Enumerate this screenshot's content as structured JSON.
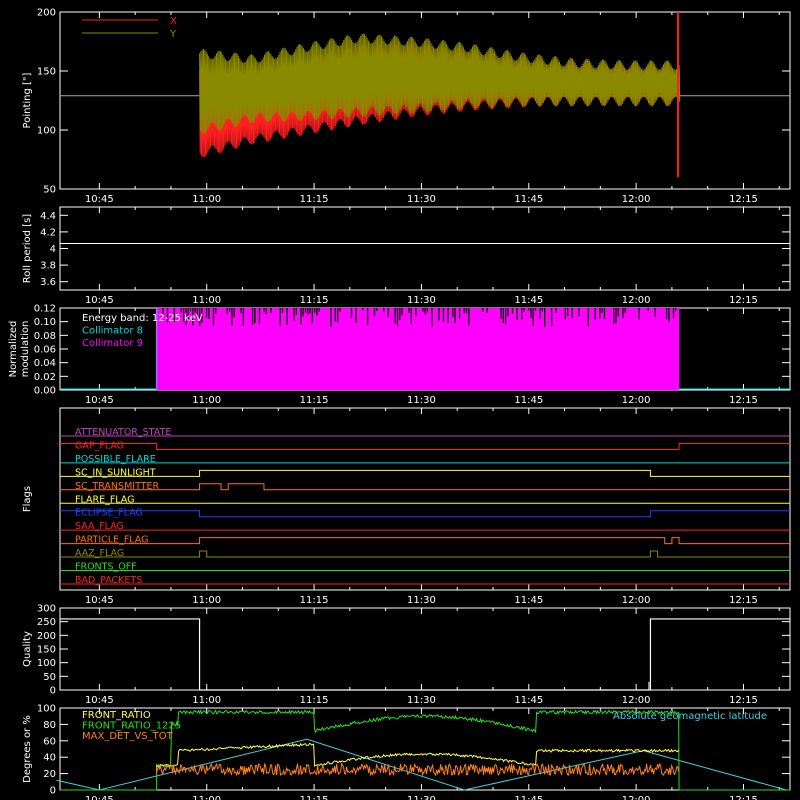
{
  "time_ticks": [
    "10:45",
    "11:00",
    "11:15",
    "11:30",
    "11:45",
    "12:00",
    "12:15"
  ],
  "chart_data": [
    {
      "type": "line",
      "ylabel": "Pointing [\"]",
      "ylim": [
        50,
        200
      ],
      "yticks": [
        50,
        100,
        150,
        200
      ],
      "legend": [
        {
          "name": "X",
          "color": "#ff2020"
        },
        {
          "name": "Y",
          "color": "#8a8a00"
        }
      ],
      "legend_position": "top-left",
      "reference_line": {
        "y": 129,
        "color": "#aaaaaa"
      },
      "series": [
        {
          "name": "X",
          "color": "#ff2020",
          "start": "10:59",
          "end": "12:06",
          "envelope_hi": [
            150,
            145,
            158,
            168,
            170,
            165,
            158,
            155,
            154,
            153
          ],
          "envelope_lo": [
            80,
            92,
            100,
            108,
            115,
            120,
            123,
            125,
            125,
            125
          ]
        },
        {
          "name": "Y",
          "color": "#8a8a00",
          "start": "10:59",
          "end": "12:06",
          "envelope_hi": [
            165,
            160,
            170,
            178,
            175,
            170,
            162,
            157,
            155,
            155
          ],
          "envelope_lo": [
            100,
            110,
            112,
            115,
            118,
            122,
            124,
            124,
            124,
            124
          ]
        }
      ]
    },
    {
      "type": "line",
      "ylabel": "Roll period [s]",
      "ylim": [
        3.5,
        4.5
      ],
      "yticks": [
        3.6,
        3.8,
        4.0,
        4.2,
        4.4
      ],
      "series": [
        {
          "name": "",
          "color": "#ffffff",
          "value": 4.06
        }
      ]
    },
    {
      "type": "bar",
      "ylabel": "Normalized modulation",
      "ylim": [
        0,
        0.12
      ],
      "yticks": [
        "0.00",
        "0.02",
        "0.04",
        "0.06",
        "0.08",
        "0.10",
        "0.12"
      ],
      "legend": [
        {
          "name": "Energy band: 12-25 keV",
          "color": "#ffffff"
        },
        {
          "name": "Collimator 8",
          "color": "#00d8d8"
        },
        {
          "name": "Collimator 9",
          "color": "#ff00ff"
        }
      ],
      "series": [
        {
          "name": "Collimator 9",
          "color": "#ff00ff",
          "start": "10:53",
          "end": "12:06"
        }
      ]
    },
    {
      "type": "table",
      "ylabel": "Flags",
      "flags": [
        {
          "name": "ATTENUATOR_STATE",
          "color": "#c040c0",
          "segments": []
        },
        {
          "name": "GAP_FLAG",
          "color": "#ff2020",
          "segments": [
            [
              "10:53",
              "12:06"
            ]
          ],
          "invert": true
        },
        {
          "name": "POSSIBLE_FLARE",
          "color": "#00d8d8",
          "segments": []
        },
        {
          "name": "SC_IN_SUNLIGHT",
          "color": "#ffff40",
          "segments": [
            [
              "10:59",
              "12:02"
            ]
          ]
        },
        {
          "name": "SC_TRANSMITTER",
          "color": "#ff7010",
          "segments": [
            [
              "10:59",
              "11:02"
            ],
            [
              "11:03",
              "11:08"
            ]
          ]
        },
        {
          "name": "FLARE_FLAG",
          "color": "#ffff40",
          "segments": []
        },
        {
          "name": "ECLIPSE_FLAG",
          "color": "#2040ff",
          "segments": [
            [
              "10:59",
              "12:02"
            ]
          ],
          "invert": true
        },
        {
          "name": "SAA_FLAG",
          "color": "#ff2020",
          "segments": []
        },
        {
          "name": "PARTICLE_FLAG",
          "color": "#ff7010",
          "segments": [
            [
              "10:59",
              "12:04"
            ],
            [
              "12:05",
              "12:06"
            ]
          ]
        },
        {
          "name": "AAZ_FLAG",
          "color": "#8a8a00",
          "segments": [
            [
              "10:59",
              "11:00"
            ],
            [
              "12:02",
              "12:03"
            ]
          ]
        },
        {
          "name": "FRONTS_OFF",
          "color": "#20e020",
          "segments": []
        },
        {
          "name": "BAD_PACKETS",
          "color": "#ff2020",
          "segments": []
        }
      ]
    },
    {
      "type": "line",
      "ylabel": "Quality",
      "ylim": [
        0,
        300
      ],
      "yticks": [
        0,
        50,
        100,
        150,
        200,
        250,
        300
      ],
      "series": [
        {
          "name": "",
          "color": "#ffffff",
          "segments": [
            {
              "from": "10:39",
              "to": "10:59",
              "value": 260
            },
            {
              "from": "12:02",
              "to": "12:20",
              "value": 260
            }
          ]
        }
      ]
    },
    {
      "type": "line",
      "ylabel": "Degrees or %",
      "ylim": [
        0,
        100
      ],
      "yticks": [
        0,
        20,
        40,
        60,
        80,
        100
      ],
      "legend": [
        {
          "name": "FRONT_RATIO",
          "color": "#ffff40"
        },
        {
          "name": "FRONT_RATIO_1225",
          "color": "#20e020"
        },
        {
          "name": "MAX_DET_VS_TOT",
          "color": "#ff8020"
        },
        {
          "name": "Absolute geomagnetic latitude",
          "color": "#40d0e0"
        }
      ],
      "series": [
        {
          "name": "FRONT_RATIO",
          "color": "#ffff40"
        },
        {
          "name": "FRONT_RATIO_1225",
          "color": "#20e020"
        },
        {
          "name": "MAX_DET_VS_TOT",
          "color": "#ff8020"
        },
        {
          "name": "Absolute geomagnetic latitude",
          "color": "#40d0e0"
        }
      ]
    }
  ]
}
